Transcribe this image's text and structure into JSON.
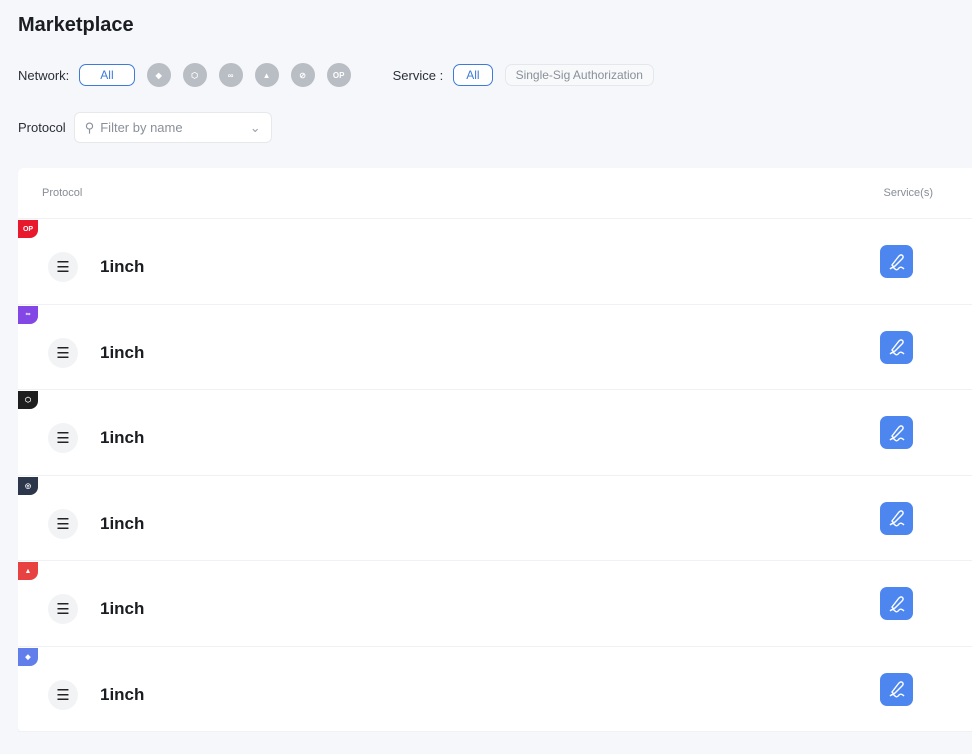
{
  "title": "Marketplace",
  "filters": {
    "network_label": "Network:",
    "network_all": "All",
    "networks": [
      {
        "name": "ethereum",
        "glyph": "◆"
      },
      {
        "name": "bnb",
        "glyph": "⬡"
      },
      {
        "name": "polygon",
        "glyph": "∞"
      },
      {
        "name": "avalanche",
        "glyph": "▲"
      },
      {
        "name": "arbitrum",
        "glyph": "⊘"
      },
      {
        "name": "optimism",
        "glyph": "OP"
      }
    ],
    "service_label": "Service :",
    "service_all": "All",
    "service_option": "Single-Sig Authorization",
    "protocol_label": "Protocol",
    "search_placeholder": "Filter by name"
  },
  "table": {
    "col_protocol": "Protocol",
    "col_services": "Service(s)",
    "rows": [
      {
        "name": "1inch",
        "network": "optimism",
        "badge": "OP",
        "color": "#e8192c"
      },
      {
        "name": "1inch",
        "network": "polygon",
        "badge": "∞",
        "color": "#8247e5"
      },
      {
        "name": "1inch",
        "network": "bnb",
        "badge": "⬡",
        "color": "#1e1e1e"
      },
      {
        "name": "1inch",
        "network": "arbitrum",
        "badge": "◎",
        "color": "#2d374b"
      },
      {
        "name": "1inch",
        "network": "avalanche",
        "badge": "▲",
        "color": "#e84142"
      },
      {
        "name": "1inch",
        "network": "ethereum",
        "badge": "◆",
        "color": "#627eea"
      }
    ]
  }
}
